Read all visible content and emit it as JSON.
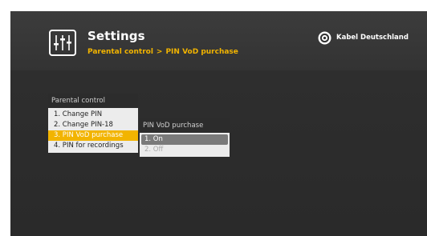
{
  "header": {
    "title": "Settings",
    "breadcrumb": {
      "parent": "Parental control",
      "separator": ">",
      "current": "PIN VoD purchase"
    },
    "brand": "Kabel Deutschland",
    "icon": "settings-sliders-icon",
    "brand_icon": "kabel-deutschland-logo-icon"
  },
  "menu": {
    "title": "Parental control",
    "items": [
      {
        "label": "1. Change PIN"
      },
      {
        "label": "2. Change PIN-18"
      },
      {
        "label": "3. PIN VoD purchase"
      },
      {
        "label": "4. PIN for recordings"
      }
    ],
    "selected_index": 2
  },
  "submenu": {
    "title": "PIN VoD purchase",
    "items": [
      {
        "label": "1. On"
      },
      {
        "label": "2. Off"
      }
    ],
    "selected_index": 0
  },
  "colors": {
    "accent": "#f2b400",
    "background": "#2e2e2e",
    "list_bg": "#ececec",
    "submenu_selected": "#7a7a7a"
  }
}
